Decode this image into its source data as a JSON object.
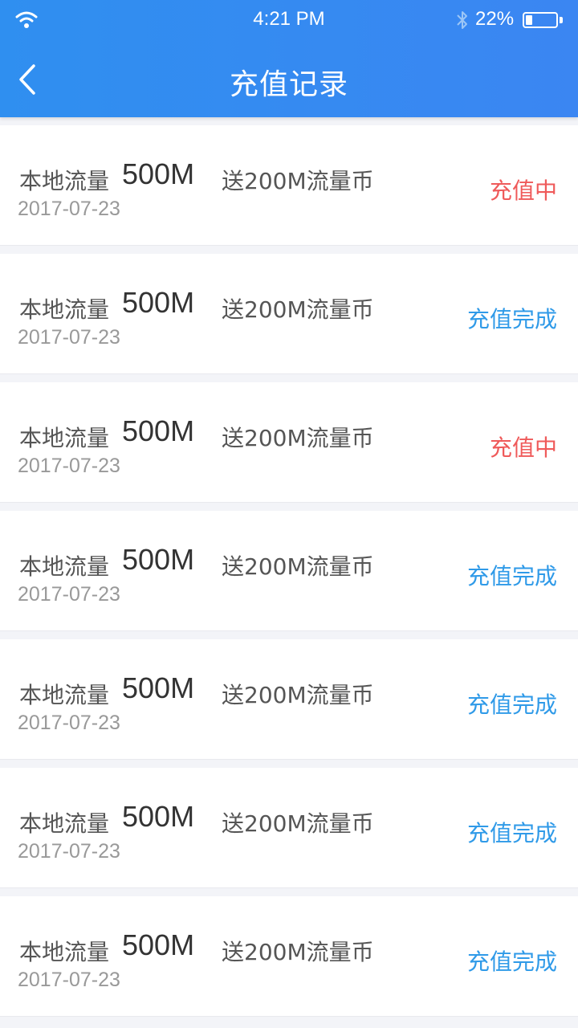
{
  "status_bar": {
    "time": "4:21 PM",
    "battery_percent": "22%",
    "battery_level": 0.22,
    "icons": [
      "wifi-icon",
      "bluetooth-icon",
      "battery-icon"
    ]
  },
  "header": {
    "title": "充值记录",
    "back_icon": "chevron-left-icon"
  },
  "colors": {
    "header": "#2f8ff0",
    "status_pending": "#ef5a5a",
    "status_done": "#2f9ae8"
  },
  "records": [
    {
      "label": "本地流量",
      "amount": "500M",
      "bonus": "送200M流量币",
      "date": "2017-07-23",
      "status": "充值中"
    },
    {
      "label": "本地流量",
      "amount": "500M",
      "bonus": "送200M流量币",
      "date": "2017-07-23",
      "status": "充值完成"
    },
    {
      "label": "本地流量",
      "amount": "500M",
      "bonus": "送200M流量币",
      "date": "2017-07-23",
      "status": "充值中"
    },
    {
      "label": "本地流量",
      "amount": "500M",
      "bonus": "送200M流量币",
      "date": "2017-07-23",
      "status": "充值完成"
    },
    {
      "label": "本地流量",
      "amount": "500M",
      "bonus": "送200M流量币",
      "date": "2017-07-23",
      "status": "充值完成"
    },
    {
      "label": "本地流量",
      "amount": "500M",
      "bonus": "送200M流量币",
      "date": "2017-07-23",
      "status": "充值完成"
    },
    {
      "label": "本地流量",
      "amount": "500M",
      "bonus": "送200M流量币",
      "date": "2017-07-23",
      "status": "充值完成"
    }
  ]
}
